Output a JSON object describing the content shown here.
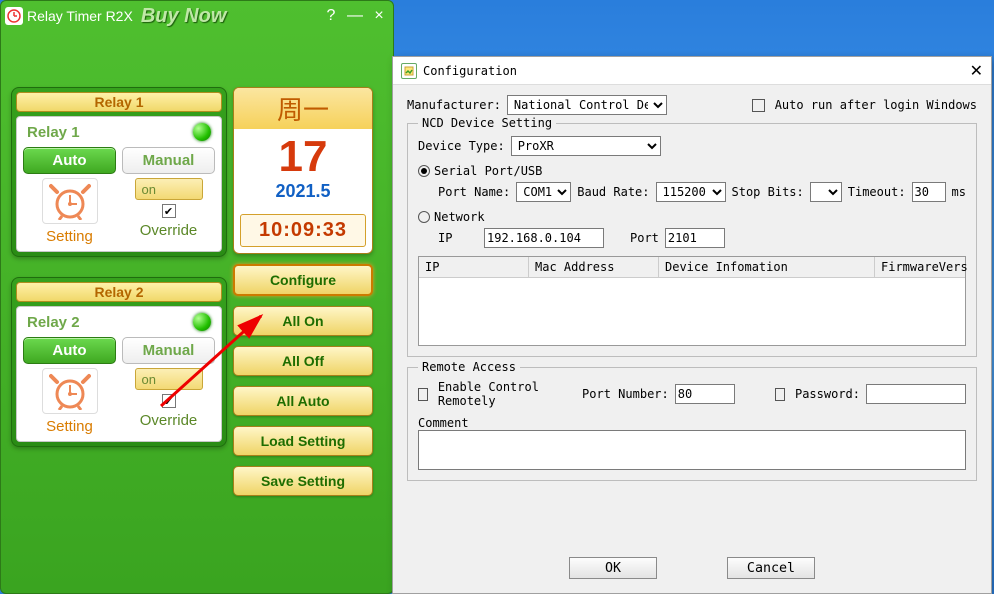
{
  "app": {
    "title": "Relay Timer R2X",
    "buy": "Buy Now",
    "help": "?",
    "minimize": "—",
    "close": "×"
  },
  "relays": [
    {
      "title": "Relay 1",
      "name": "Relay 1",
      "auto": "Auto",
      "manual": "Manual",
      "state": "on",
      "setting": "Setting",
      "override": "Override"
    },
    {
      "title": "Relay 2",
      "name": "Relay 2",
      "auto": "Auto",
      "manual": "Manual",
      "state": "on",
      "setting": "Setting",
      "override": "Override"
    }
  ],
  "calendar": {
    "weekday": "周一",
    "day": "17",
    "yearmonth": "2021.5",
    "time": "10:09:33"
  },
  "sidebtns": {
    "configure": "Configure",
    "allon": "All On",
    "alloff": "All Off",
    "allauto": "All Auto",
    "load": "Load Setting",
    "save": "Save Setting"
  },
  "cfg": {
    "title": "Configuration",
    "manufacturer_lbl": "Manufacturer:",
    "manufacturer_val": "National Control Dev.",
    "autorun": "Auto run after login Windows",
    "ncd_legend": "NCD Device Setting",
    "devtype_lbl": "Device Type:",
    "devtype_val": "ProXR",
    "conn_serial": "Serial Port/USB",
    "conn_network": "Network",
    "portname_lbl": "Port Name:",
    "portname_val": "COM1",
    "baud_lbl": "Baud Rate:",
    "baud_val": "115200",
    "stopbits_lbl": "Stop Bits:",
    "stopbits_val": "",
    "timeout_lbl": "Timeout:",
    "timeout_val": "30",
    "timeout_unit": "ms",
    "ip_lbl": "IP",
    "ip_val": "192.168.0.104",
    "port_lbl": "Port",
    "port_val": "2101",
    "col_ip": "IP",
    "col_mac": "Mac Address",
    "col_dev": "Device Infomation",
    "col_fw": "FirmwareVers",
    "remote_legend": "Remote Access",
    "enable_remote": "Enable Control Remotely",
    "portnum_lbl": "Port Number:",
    "portnum_val": "80",
    "password_lbl": "Password:",
    "password_val": "",
    "comment_lbl": "Comment",
    "ok": "OK",
    "cancel": "Cancel"
  }
}
